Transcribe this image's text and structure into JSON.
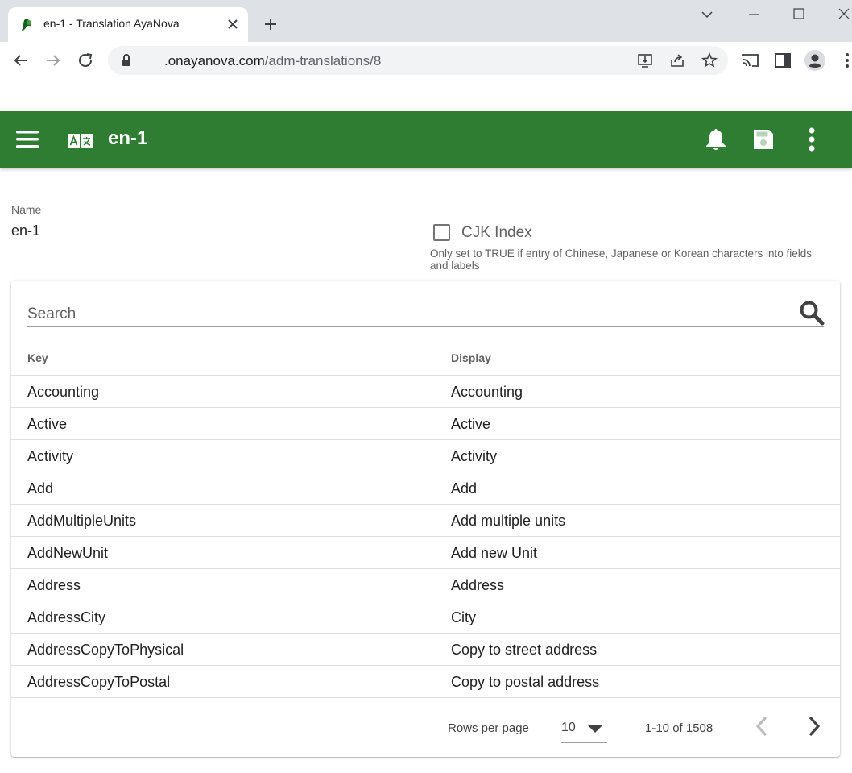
{
  "browser": {
    "tab_title": "en-1 - Translation AyaNova",
    "url_domain": ".onayanova.com",
    "url_path": "/adm-translations/8"
  },
  "appbar": {
    "title": "en-1",
    "color": "#2e7d32"
  },
  "form": {
    "name_label": "Name",
    "name_value": "en-1",
    "cjk_label": "CJK Index",
    "cjk_checked": false,
    "cjk_hint": "Only set to TRUE if entry of Chinese, Japanese or Korean characters into fields and labels"
  },
  "table": {
    "search_placeholder": "Search",
    "columns": [
      "Key",
      "Display"
    ],
    "rows": [
      {
        "key": "Accounting",
        "display": "Accounting"
      },
      {
        "key": "Active",
        "display": "Active"
      },
      {
        "key": "Activity",
        "display": "Activity"
      },
      {
        "key": "Add",
        "display": "Add"
      },
      {
        "key": "AddMultipleUnits",
        "display": "Add multiple units"
      },
      {
        "key": "AddNewUnit",
        "display": "Add new Unit"
      },
      {
        "key": "Address",
        "display": "Address"
      },
      {
        "key": "AddressCity",
        "display": "City"
      },
      {
        "key": "AddressCopyToPhysical",
        "display": "Copy to street address"
      },
      {
        "key": "AddressCopyToPostal",
        "display": "Copy to postal address"
      }
    ],
    "footer": {
      "rows_per_page_label": "Rows per page",
      "rows_per_page_value": "10",
      "range": "1-10 of 1508"
    }
  }
}
